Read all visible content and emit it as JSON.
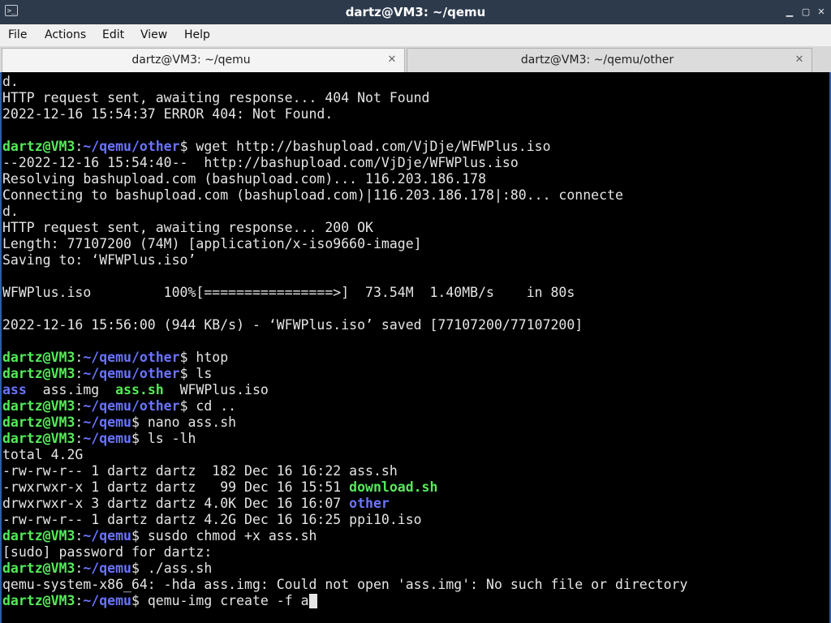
{
  "window": {
    "title": "dartz@VM3: ~/qemu",
    "app_icon": "terminal-icon",
    "icons": {
      "minimize": "minimize-icon",
      "maximize": "maximize-icon",
      "close": "close-icon"
    },
    "colors": {
      "titlebar": "#2d3a4c",
      "terminal_bg": "#000000",
      "prompt_user": "#56e95a",
      "prompt_path": "#6b74ff",
      "text": "#e5e5e5"
    }
  },
  "menu": {
    "items": [
      "File",
      "Actions",
      "Edit",
      "View",
      "Help"
    ]
  },
  "tabs": [
    {
      "label": "dartz@VM3: ~/qemu",
      "active": true
    },
    {
      "label": "dartz@VM3: ~/qemu/other",
      "active": false
    }
  ],
  "terminal": {
    "prompt_user": "dartz@VM3",
    "prompt_path_other": "~/qemu/other",
    "prompt_path_qemu": "~/qemu",
    "lines": [
      "d.",
      "HTTP request sent, awaiting response... 404 Not Found",
      "2022-12-16 15:54:37 ERROR 404: Not Found.",
      "",
      " wget http://bashupload.com/VjDje/WFWPlus.iso",
      "--2022-12-16 15:54:40--  http://bashupload.com/VjDje/WFWPlus.iso",
      "Resolving bashupload.com (bashupload.com)... 116.203.186.178",
      "Connecting to bashupload.com (bashupload.com)|116.203.186.178|:80... connecte",
      "d.",
      "HTTP request sent, awaiting response... 200 OK",
      "Length: 77107200 (74M) [application/x-iso9660-image]",
      "Saving to: ‘WFWPlus.iso’",
      "",
      "WFWPlus.iso         100%[================>]  73.54M  1.40MB/s    in 80s",
      "",
      "2022-12-16 15:56:00 (944 KB/s) - ‘WFWPlus.iso’ saved [77107200/77107200]",
      "",
      " htop",
      " ls",
      "",
      " cd ..",
      " nano ass.sh",
      " ls -lh",
      "total 4.2G",
      "-rw-rw-r-- 1 dartz dartz  182 Dec 16 16:22 ass.sh",
      "-rwxrwxr-x 1 dartz dartz   99 Dec 16 15:51 ",
      "drwxrwxr-x 3 dartz dartz 4.0K Dec 16 16:07 ",
      "-rw-rw-r-- 1 dartz dartz 4.2G Dec 16 16:25 ppi10.iso",
      " susdo chmod +x ass.sh",
      "[sudo] password for dartz:",
      " ./ass.sh",
      "qemu-system-x86_64: -hda ass.img: Could not open 'ass.img': No such file or directory",
      " qemu-img create -f a"
    ],
    "ls_output": {
      "dir_ass": "ass",
      "sep_1": "  ass.img  ",
      "exec_ass_sh": "ass.sh",
      "sep_2": "  WFWPlus.iso"
    },
    "ls_long": {
      "exec_download": "download.sh",
      "dir_other": "other"
    }
  }
}
